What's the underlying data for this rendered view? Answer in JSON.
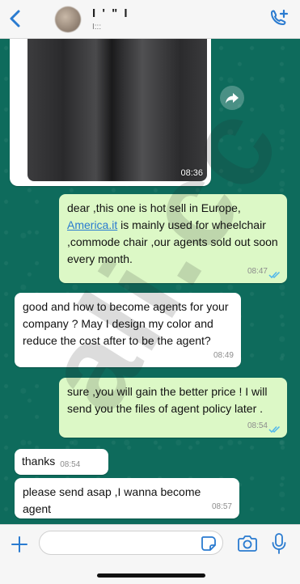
{
  "header": {
    "contact_name": "I ' \" I",
    "contact_status": "I:::"
  },
  "image_message": {
    "time": "08:36"
  },
  "messages": [
    {
      "direction": "out",
      "text_before_link": "dear ,this one is hot sell in Europe, ",
      "link_text": "America.it",
      "text_after_link": " is mainly used for wheelchair ,commode chair  ,our agents sold out soon every month.",
      "time": "08:47"
    },
    {
      "direction": "in",
      "text": "good and how to  become agents for your company ? May I design my color and reduce the cost after to be the agent?",
      "time": "08:49"
    },
    {
      "direction": "out",
      "text": "sure ,you will gain the better price ! I will send you the files of agent policy later .",
      "time": "08:54"
    },
    {
      "direction": "in",
      "text": "thanks",
      "time": "08:54"
    },
    {
      "direction": "in",
      "text": "please send asap ,I wanna become agent",
      "time": "08:57"
    }
  ],
  "composer": {
    "input_value": ""
  },
  "watermark": {
    "text": "ali.cc"
  },
  "colors": {
    "header_bg": "#f6f6f6",
    "chat_bg": "#0e6b5c",
    "outgoing_bubble": "#dcf8c6",
    "incoming_bubble": "#ffffff",
    "accent": "#2a7bd0",
    "read_ticks": "#4fb6ec"
  },
  "icons": [
    "chevron-left-icon",
    "add-call-icon",
    "forward-icon",
    "double-check-icon",
    "plus-icon",
    "sticker-icon",
    "camera-icon",
    "mic-icon"
  ]
}
